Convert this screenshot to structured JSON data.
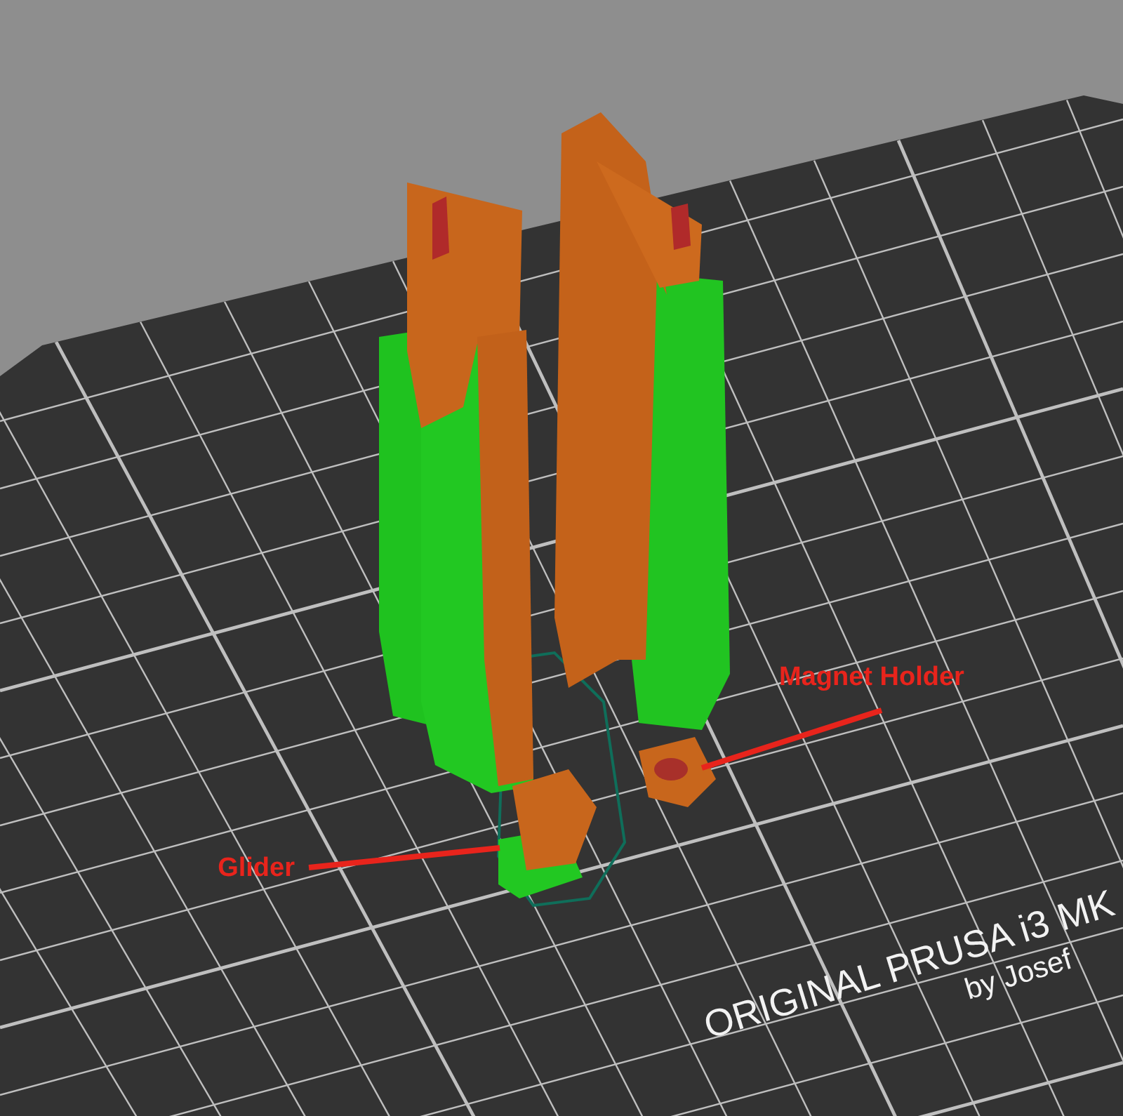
{
  "viewport": {
    "bed_texts": [
      {
        "text": "ORIGINAL PRUSA i3 MK"
      },
      {
        "text": "by Josef"
      }
    ]
  },
  "annotations": [
    {
      "label": "Magnet Holder"
    },
    {
      "label": "Glider"
    }
  ]
}
